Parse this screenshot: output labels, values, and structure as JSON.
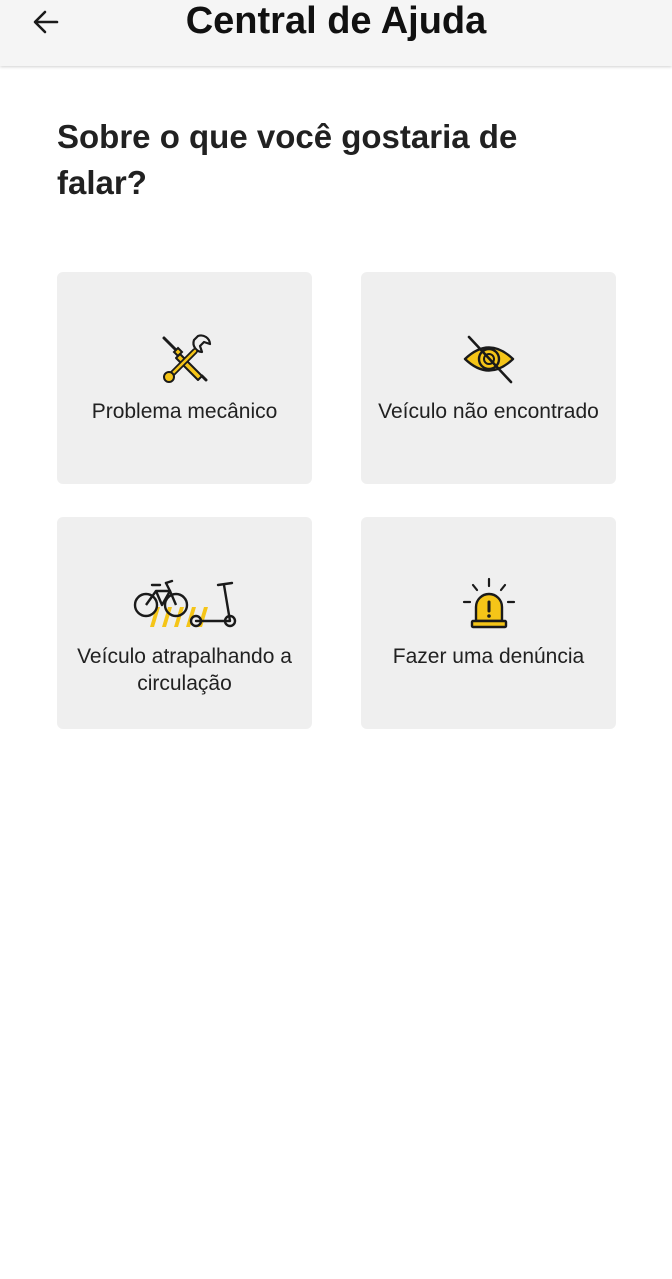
{
  "header": {
    "title": "Central de Ajuda",
    "back_icon": "arrow-left-icon"
  },
  "main": {
    "question": "Sobre o que você gostaria de falar?",
    "topics": [
      {
        "label": "Problema mecânico",
        "icon": "tools-icon"
      },
      {
        "label": "Veículo não encontrado",
        "icon": "eye-off-icon"
      },
      {
        "label": "Veículo atrapalhando a circulação",
        "icon": "bike-scooter-crosswalk-icon"
      },
      {
        "label": "Fazer uma denúncia",
        "icon": "siren-alarm-icon"
      }
    ]
  },
  "colors": {
    "accent": "#f5c518",
    "card_background": "#efefef",
    "header_background": "#f5f5f5",
    "text": "#212121"
  }
}
